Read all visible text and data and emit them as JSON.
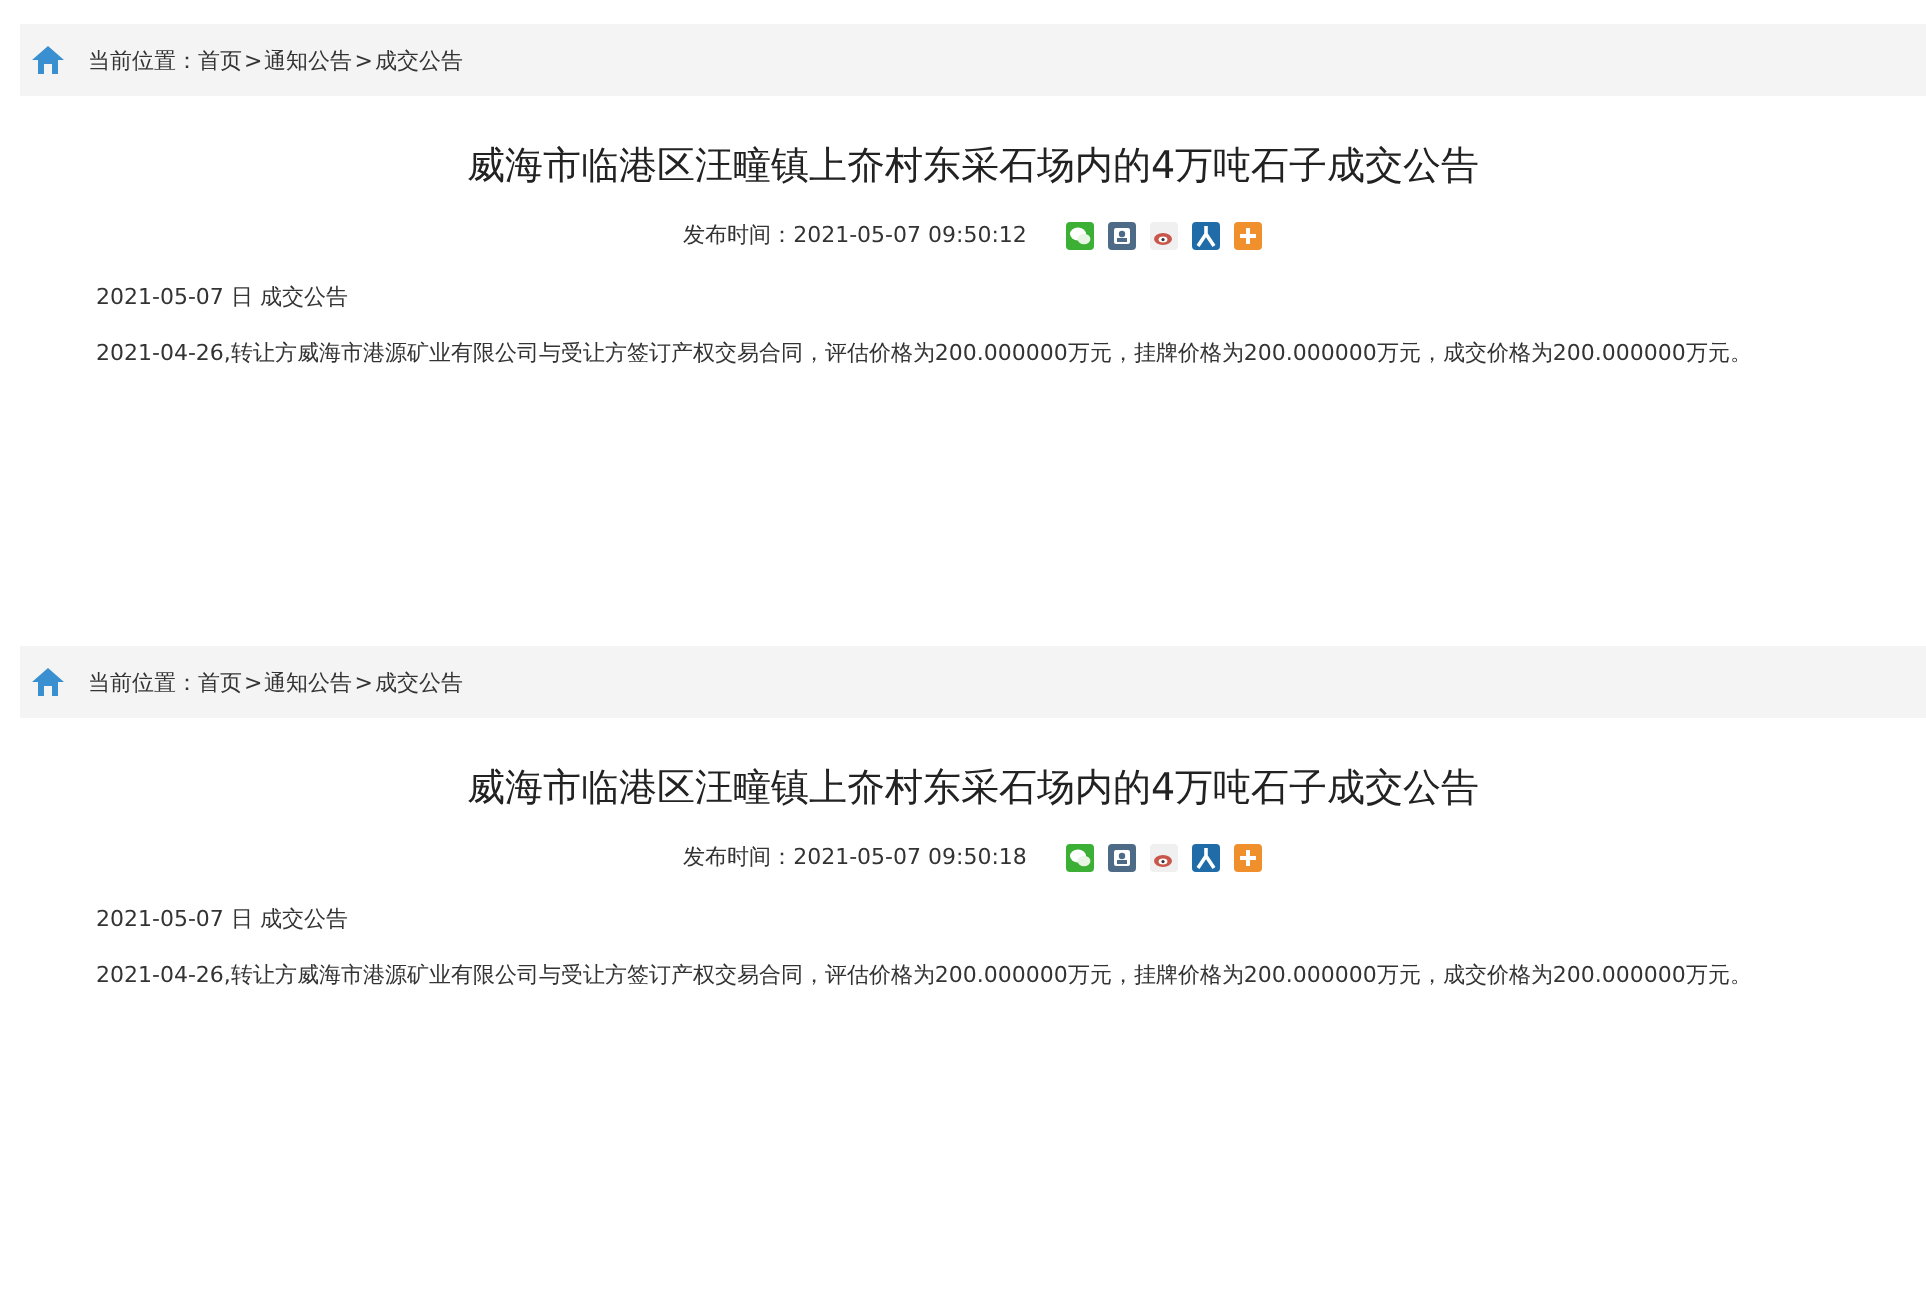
{
  "panels": [
    {
      "breadcrumb": {
        "label": "当前位置：",
        "separator": ">",
        "items": [
          "首页",
          "通知公告",
          "成交公告"
        ]
      },
      "title": "威海市临港区汪疃镇上夼村东采石场内的4万吨石子成交公告",
      "publish_time": "发布时间：2021-05-07 09:50:12",
      "share_icons": [
        {
          "kind": "wechat"
        },
        {
          "kind": "qq"
        },
        {
          "kind": "weibo"
        },
        {
          "kind": "renren"
        },
        {
          "kind": "more"
        }
      ],
      "date_line": "2021-05-07 日 成交公告",
      "body": "2021-04-26,转让方威海市港源矿业有限公司与受让方签订产权交易合同，评估价格为200.000000万元，挂牌价格为200.000000万元，成交价格为200.000000万元。"
    },
    {
      "breadcrumb": {
        "label": "当前位置：",
        "separator": ">",
        "items": [
          "首页",
          "通知公告",
          "成交公告"
        ]
      },
      "title": "威海市临港区汪疃镇上夼村东采石场内的4万吨石子成交公告",
      "publish_time": "发布时间：2021-05-07 09:50:18",
      "share_icons": [
        {
          "kind": "wechat"
        },
        {
          "kind": "qq"
        },
        {
          "kind": "weibo"
        },
        {
          "kind": "renren"
        },
        {
          "kind": "more"
        }
      ],
      "date_line": "2021-05-07 日 成交公告",
      "body": "2021-04-26,转让方威海市港源矿业有限公司与受让方签订产权交易合同，评估价格为200.000000万元，挂牌价格为200.000000万元，成交价格为200.000000万元。"
    }
  ]
}
